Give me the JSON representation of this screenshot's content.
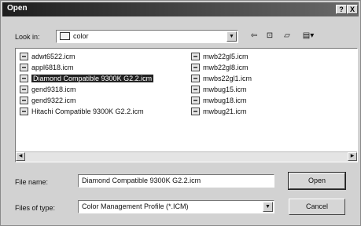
{
  "window": {
    "title": "Open",
    "help_btn": "?",
    "close_btn": "X"
  },
  "look_in": {
    "label": "Look in:",
    "value": "color"
  },
  "files": {
    "col1": [
      {
        "name": "adwt6522.icm",
        "selected": false
      },
      {
        "name": "appl6818.icm",
        "selected": false
      },
      {
        "name": "Diamond Compatible 9300K G2.2.icm",
        "selected": true
      },
      {
        "name": "gend9318.icm",
        "selected": false
      },
      {
        "name": "gend9322.icm",
        "selected": false
      },
      {
        "name": "Hitachi Compatible 9300K G2.2.icm",
        "selected": false
      }
    ],
    "col2": [
      {
        "name": "mwb22gl5.icm",
        "selected": false
      },
      {
        "name": "mwb22gl8.icm",
        "selected": false
      },
      {
        "name": "mwbs22gl1.icm",
        "selected": false
      },
      {
        "name": "mwbug15.icm",
        "selected": false
      },
      {
        "name": "mwbug18.icm",
        "selected": false
      },
      {
        "name": "mwbug21.icm",
        "selected": false
      }
    ]
  },
  "file_name": {
    "label": "File name:",
    "value": "Diamond Compatible 9300K G2.2.icm"
  },
  "file_type": {
    "label": "Files of type:",
    "value": "Color Management Profile (*.ICM)"
  },
  "buttons": {
    "open": "Open",
    "cancel": "Cancel"
  }
}
